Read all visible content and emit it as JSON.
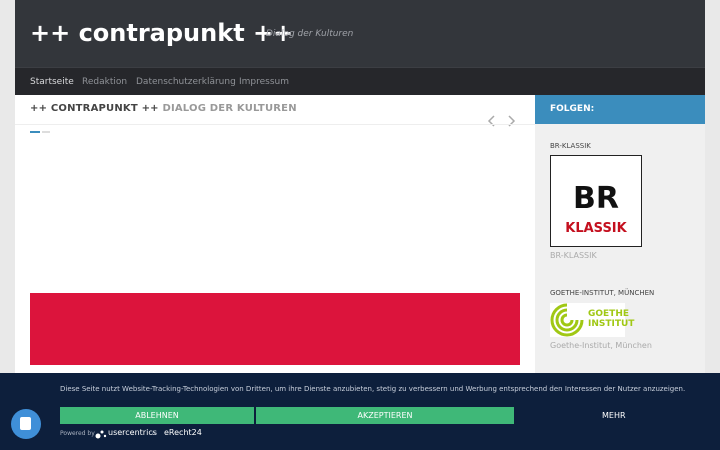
{
  "header": {
    "title": "++ contrapunkt ++",
    "description": "Dialog der Kulturen"
  },
  "nav": {
    "items": [
      "Startseite",
      "Redaktion",
      "Datenschutzerklärung",
      "Impressum"
    ]
  },
  "main": {
    "heading_part1": "++ CONTRAPUNKT ++",
    "heading_part2": "DIALOG DER KULTUREN",
    "prev_icon": "chevron-left-icon",
    "next_icon": "chevron-right-icon",
    "block_color": "#dc143c"
  },
  "sidebar": {
    "follow_label": "FOLGEN:",
    "follow_color": "#3b8dbd",
    "widgets": [
      {
        "title": "BR-KLASSIK",
        "caption": "BR-KLASSIK",
        "logo_br": "BR",
        "logo_klassik": "KLASSIK"
      },
      {
        "title": "GOETHE-INSTITUT, MÜNCHEN",
        "caption": "Goethe-Institut, München",
        "logo_line1": "GOETHE",
        "logo_line2": "INSTITUT"
      }
    ]
  },
  "cookie": {
    "text": "Diese Seite nutzt Website-Tracking-Technologien von Dritten, um ihre Dienste anzubieten, stetig zu verbessern und Werbung entsprechend den Interessen der Nutzer anzuzeigen.",
    "reject_label": "ABLEHNEN",
    "accept_label": "AKZEPTIEREN",
    "more_label": "MEHR",
    "powered_by": "Powered by",
    "brand1": "usercentrics",
    "amp": "&",
    "brand2": "eRecht24",
    "button_color": "#3fb878"
  }
}
